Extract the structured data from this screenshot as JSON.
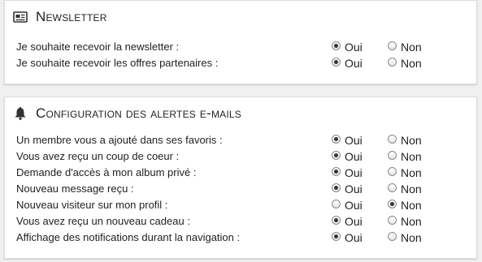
{
  "newsletter": {
    "title": "Newsletter",
    "icon": "newspaper-icon",
    "option_yes": "Oui",
    "option_no": "Non",
    "rows": [
      {
        "label": "Je souhaite recevoir la newsletter :",
        "selected": "Oui"
      },
      {
        "label": "Je souhaite recevoir les offres partenaires :",
        "selected": "Oui"
      }
    ]
  },
  "alerts": {
    "title": "Configuration des alertes e-mails",
    "icon": "bell-icon",
    "option_yes": "Oui",
    "option_no": "Non",
    "rows": [
      {
        "label": "Un membre vous a ajouté dans ses favoris :",
        "selected": "Oui"
      },
      {
        "label": "Vous avez reçu un coup de coeur :",
        "selected": "Oui"
      },
      {
        "label": "Demande d'accès à mon album privé :",
        "selected": "Oui"
      },
      {
        "label": "Nouveau message reçu :",
        "selected": "Oui"
      },
      {
        "label": "Nouveau visiteur sur mon profil :",
        "selected": "Non"
      },
      {
        "label": "Vous avez reçu un nouveau cadeau :",
        "selected": "Oui"
      },
      {
        "label": "Affichage des notifications durant la navigation :",
        "selected": "Oui"
      }
    ]
  }
}
